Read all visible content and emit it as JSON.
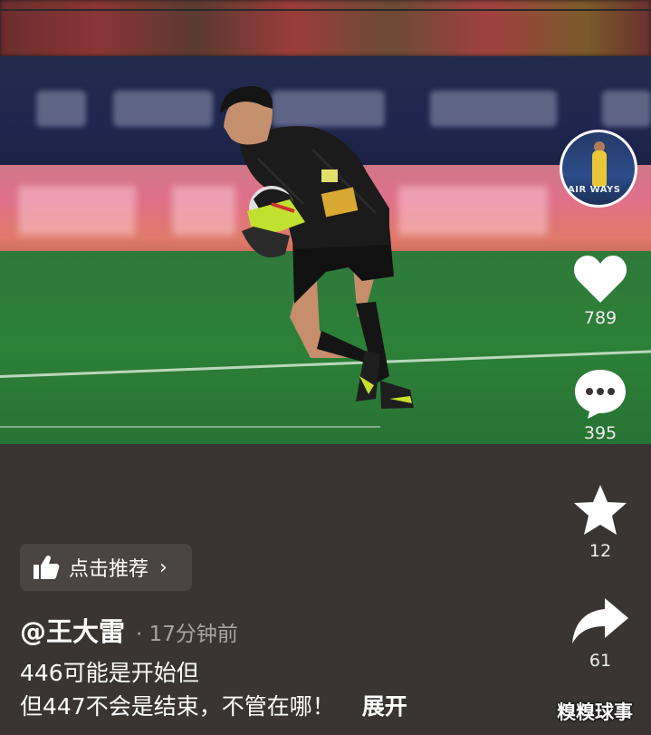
{
  "video": {
    "avatar_text": "AIR WAYS"
  },
  "actions": {
    "like_count": "789",
    "comment_count": "395",
    "favorite_count": "12",
    "share_count": "61"
  },
  "recommend": {
    "label": "点击推荐",
    "arrow": "›"
  },
  "post": {
    "author": "@王大雷",
    "time": "· 17分钟前",
    "caption_line1": "446可能是开始但",
    "caption_line2": "但447不会是结束，不管在哪！",
    "expand_label": "展开"
  },
  "watermark": "糗糗球事",
  "colors": {
    "background": "#3a3533",
    "text": "#ffffff",
    "muted_text": "#a8a4a2",
    "recommend_bg": "#4a4442"
  },
  "icons": [
    "heart-icon",
    "comment-icon",
    "star-icon",
    "share-icon",
    "thumbs-up-icon",
    "chevron-right-icon"
  ]
}
